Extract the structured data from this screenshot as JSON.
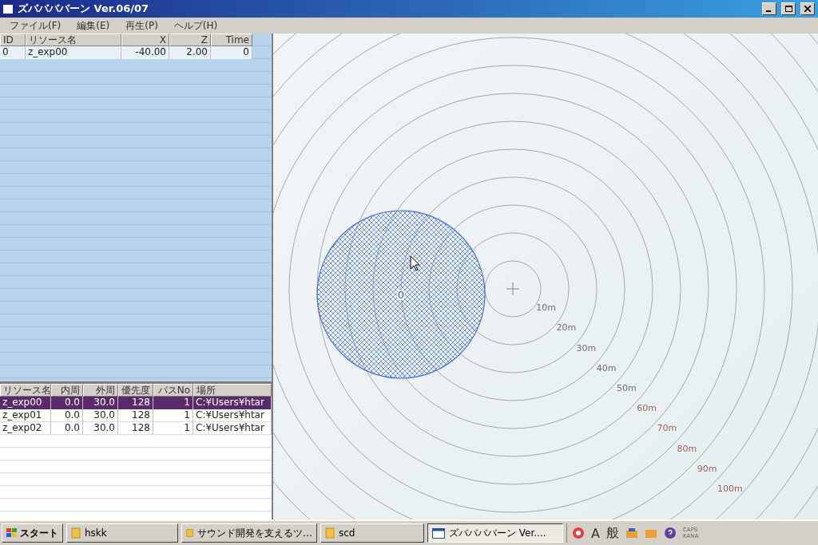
{
  "window": {
    "title": "ズババババーン Ver.06/07"
  },
  "menu": [
    {
      "label": "ファイル(F)"
    },
    {
      "label": "編集(E)"
    },
    {
      "label": "再生(P)"
    },
    {
      "label": "ヘルプ(H)"
    }
  ],
  "placement_table": {
    "columns": [
      "ID",
      "リソース名",
      "X",
      "Z",
      "Time"
    ],
    "rows": [
      {
        "cells": [
          "0",
          "z_exp00",
          "-40.00",
          "2.00",
          "0"
        ]
      }
    ]
  },
  "resource_table": {
    "columns": [
      "リソース名",
      "内周",
      "外周",
      "優先度",
      "パスNo",
      "場所"
    ],
    "rows": [
      {
        "cells": [
          "z_exp00",
          "0.0",
          "30.0",
          "128",
          "1",
          "C:¥Users¥htar"
        ],
        "selected": true
      },
      {
        "cells": [
          "z_exp01",
          "0.0",
          "30.0",
          "128",
          "1",
          "C:¥Users¥htar"
        ],
        "selected": false
      },
      {
        "cells": [
          "z_exp02",
          "0.0",
          "30.0",
          "128",
          "1",
          "C:¥Users¥htar"
        ],
        "selected": false
      }
    ]
  },
  "map": {
    "source_label": "0",
    "ring_labels": [
      "10m",
      "20m",
      "30m",
      "40m",
      "50m",
      "60m",
      "70m",
      "80m",
      "90m",
      "100m"
    ]
  },
  "taskbar": {
    "start": "スタート",
    "tasks": [
      {
        "label": "hskk",
        "kind": "folder",
        "selected": false
      },
      {
        "label": "サウンド開発を支えるツ…",
        "kind": "folder",
        "selected": false
      },
      {
        "label": "scd",
        "kind": "folder",
        "selected": false
      },
      {
        "label": "ズババババーン Ver....",
        "kind": "window",
        "selected": true
      }
    ],
    "ime": [
      "A",
      "般"
    ],
    "locks": [
      "CAPS",
      "KANA"
    ]
  }
}
